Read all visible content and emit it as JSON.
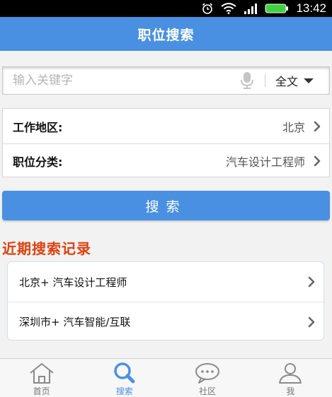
{
  "status_bar": {
    "time": "13:42"
  },
  "header": {
    "title": "职位搜索"
  },
  "search": {
    "placeholder": "输入关键字",
    "value": "",
    "scope_label": "全文"
  },
  "filters": [
    {
      "label": "工作地区:",
      "value": "北京"
    },
    {
      "label": "职位分类:",
      "value": "汽车设计工程师"
    }
  ],
  "search_button": {
    "label": "搜索"
  },
  "recent": {
    "title": "近期搜索记录",
    "items": [
      {
        "text": "北京+ 汽车设计工程师"
      },
      {
        "text": "深圳市+ 汽车智能/互联"
      }
    ]
  },
  "tabs": [
    {
      "label": "首页",
      "icon": "home-icon"
    },
    {
      "label": "搜索",
      "icon": "search-icon",
      "active": true
    },
    {
      "label": "社区",
      "icon": "chat-bubble-icon"
    },
    {
      "label": "我",
      "icon": "user-icon"
    }
  ],
  "colors": {
    "primary": "#4a90e2",
    "accent": "#e0400e"
  }
}
